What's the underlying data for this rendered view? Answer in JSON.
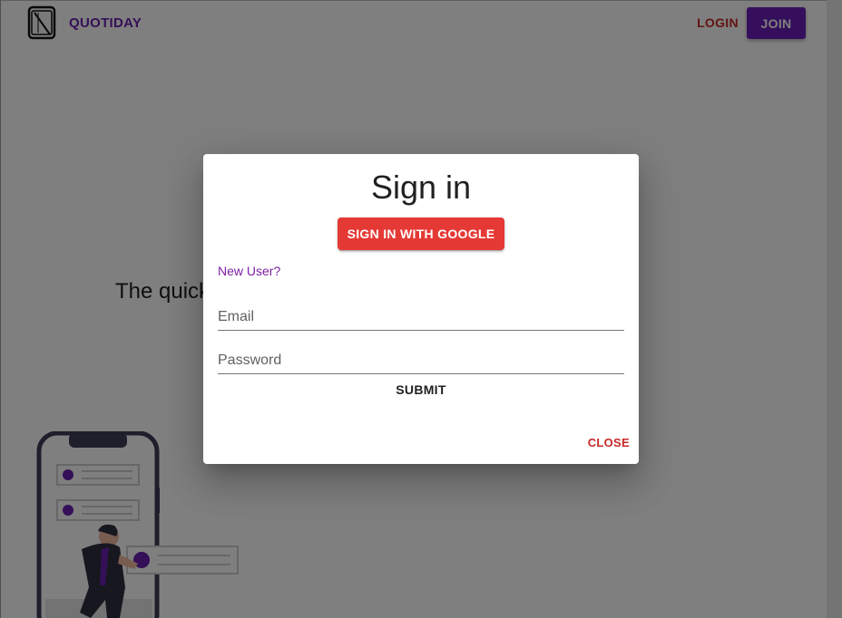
{
  "header": {
    "brand": "QUOTIDAY",
    "login_label": "LOGIN",
    "join_label": "JOIN"
  },
  "main": {
    "tagline": "The quick"
  },
  "dialog": {
    "title": "Sign in",
    "google_button": "SIGN IN WITH GOOGLE",
    "new_user_link": "New User?",
    "email_placeholder": "Email",
    "password_placeholder": "Password",
    "submit_label": "SUBMIT",
    "close_label": "CLOSE"
  },
  "colors": {
    "brand": "#6a1fb0",
    "join_button": "#6a1fb8",
    "login_text": "#c62828",
    "google_button": "#e53935",
    "link": "#7b1fa2",
    "close_text": "#c62828"
  },
  "icons": {
    "logo": "notebook-logo-icon",
    "illustration": "phone-person-illustration"
  }
}
